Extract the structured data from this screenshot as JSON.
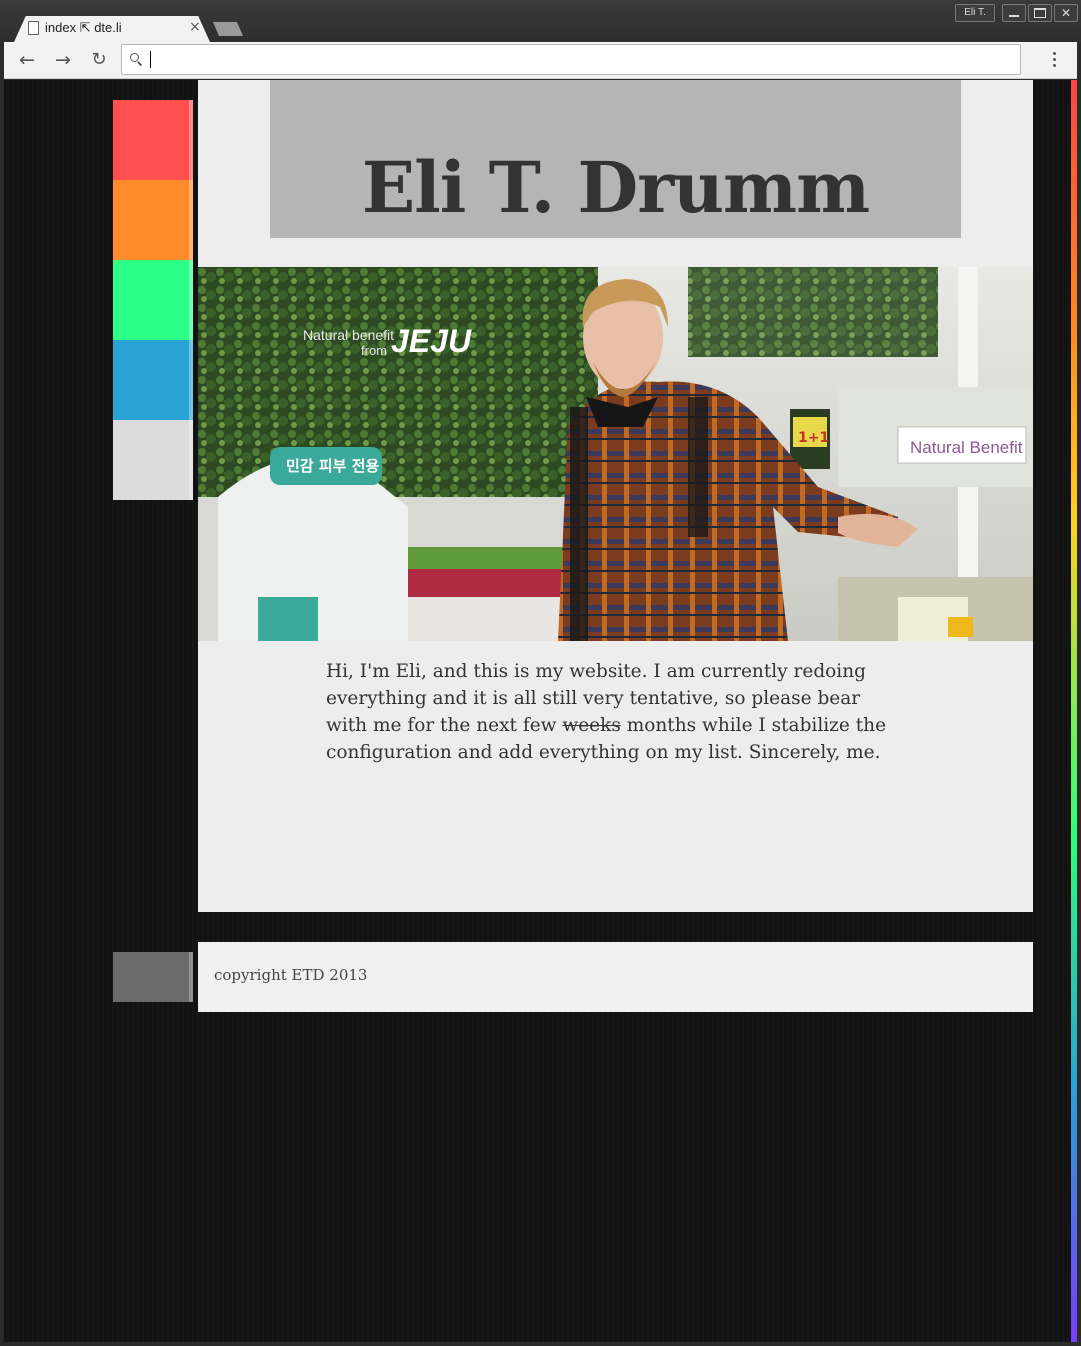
{
  "browser": {
    "tab_title": "index ⇱ dte.li",
    "tab_close": "×",
    "profile_name": "Eli T.",
    "close_glyph": "✕",
    "nav_back": "←",
    "nav_forward": "→",
    "nav_reload": "↻",
    "address_value": "",
    "icons": [
      "page-icon",
      "search-icon",
      "back-arrow-icon",
      "forward-arrow-icon",
      "reload-icon",
      "menu-dots-icon"
    ]
  },
  "page": {
    "title": "Eli T. Drumm",
    "intro_before": "Hi, I'm Eli, and this is my website. I am currently redoing everything and it is all still very tentative, so please bear with me for the next few ",
    "intro_struck": "weeks",
    "intro_after": " months while I stabilize the configuration and add everything on my list. Sincerely, me.",
    "hero_sign_1": "Natural benefit",
    "hero_sign_2": "from",
    "hero_sign_3": "JEJU",
    "hero_sign_4": "Natural Benefit",
    "hero_sign_5": "민감 피부 전용",
    "hero_sign_6": "1+1",
    "footer": "copyright ETD 2013"
  },
  "colors": {
    "swatches": [
      "#ff4f4f",
      "#ff8a2a",
      "#2cff86",
      "#29a3d3",
      "#dcdcdc"
    ],
    "footer_swatch": "#6b6b6b",
    "background": "#121212",
    "content_bg": "#ededed",
    "title_box": "#b5b5b5"
  }
}
